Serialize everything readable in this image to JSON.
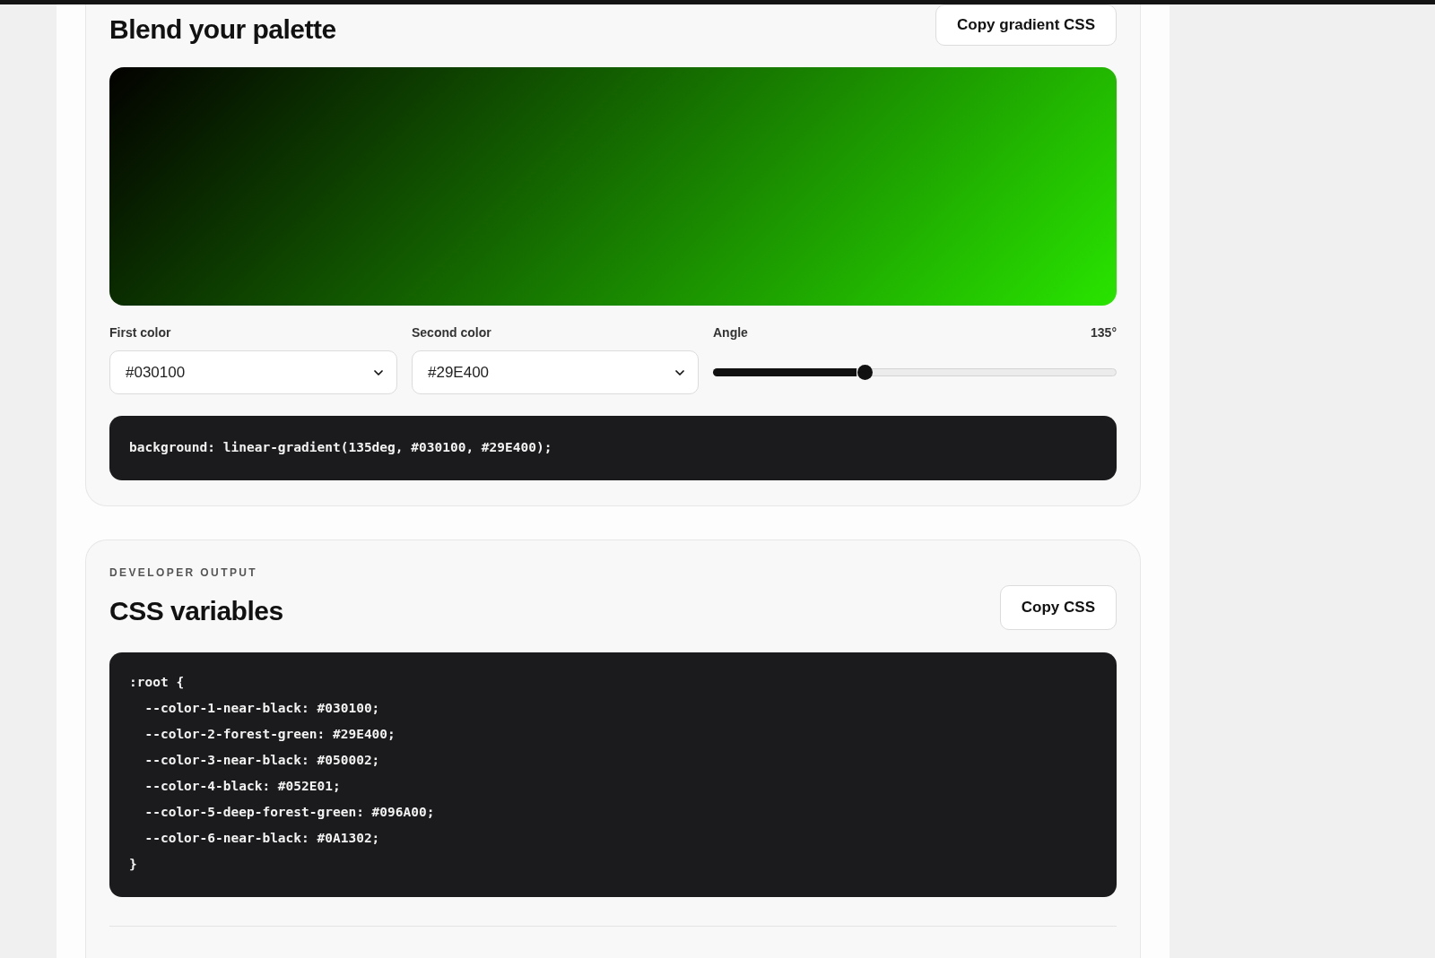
{
  "gradient_card": {
    "title": "Blend your palette",
    "copy_button": "Copy gradient CSS",
    "first_color": {
      "label": "First color",
      "value": "#030100"
    },
    "second_color": {
      "label": "Second color",
      "value": "#29E400"
    },
    "angle": {
      "label": "Angle",
      "reading": "135°",
      "level": 0.375
    },
    "css_line": "background: linear-gradient(135deg, #030100, #29E400);"
  },
  "output_card": {
    "eyebrow": "DEVELOPER OUTPUT",
    "title": "CSS variables",
    "copy_button": "Copy CSS",
    "code_lines": [
      ":root {",
      "  --color-1-near-black: #030100;",
      "  --color-2-forest-green: #29E400;",
      "  --color-3-near-black: #050002;",
      "  --color-4-black: #052E01;",
      "  --color-5-deep-forest-green: #096A00;",
      "  --color-6-near-black: #0A1302;",
      "}"
    ]
  }
}
